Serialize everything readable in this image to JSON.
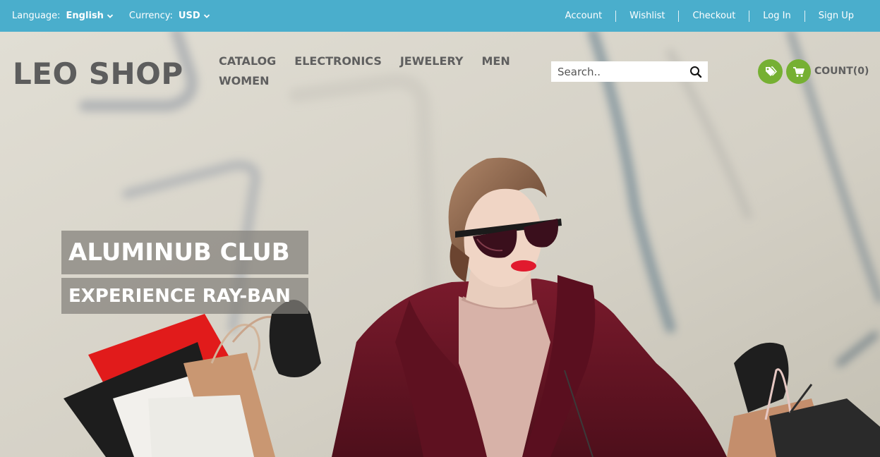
{
  "topbar": {
    "language_label": "Language:",
    "language_value": "English",
    "currency_label": "Currency:",
    "currency_value": "USD",
    "links": [
      "Account",
      "Wishlist",
      "Checkout",
      "Log In",
      "Sign Up"
    ]
  },
  "header": {
    "logo": "LEO SHOP",
    "nav": [
      "CATALOG",
      "ELECTRONICS",
      "JEWELERY",
      "MEN",
      "WOMEN"
    ],
    "search_placeholder": "Search..",
    "cart_label": "COUNT(0)"
  },
  "slide": {
    "title": "ALUMINUB CLUB",
    "subtitle": "EXPERIENCE RAY-BAN"
  },
  "colors": {
    "topbar": "#4aaecc",
    "accent_green": "#76b033",
    "coat": "#6b1424"
  },
  "icons": {
    "search": "search-icon",
    "tag": "tag-icon",
    "cart": "cart-icon",
    "chevron": "chevron-down-icon"
  }
}
